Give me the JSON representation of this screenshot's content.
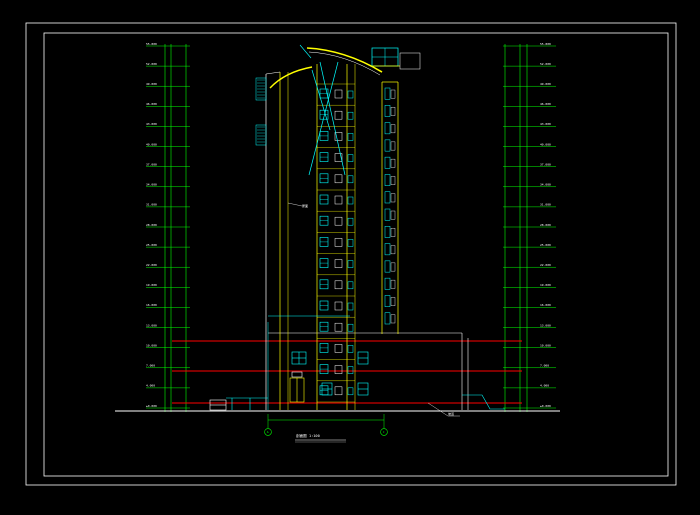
{
  "drawing": {
    "title": "剖面图 1:100",
    "colors": {
      "background": "#000000",
      "frame": "#ffffff",
      "wall": "#ffff00",
      "window": "#00ffff",
      "floor_band": "#ff0000",
      "dim": "#00ff00",
      "ground": "#ffffff"
    },
    "left_levels": [
      "55.800",
      "52.000",
      "49.000",
      "46.000",
      "43.000",
      "40.000",
      "37.000",
      "34.000",
      "31.000",
      "28.000",
      "25.000",
      "22.000",
      "19.000",
      "16.000",
      "13.000",
      "10.000",
      "7.000",
      "4.000",
      "±0.000"
    ],
    "right_levels": [
      "55.800",
      "52.000",
      "49.000",
      "46.000",
      "43.000",
      "40.000",
      "37.000",
      "34.000",
      "31.000",
      "28.000",
      "25.000",
      "22.000",
      "19.000",
      "16.000",
      "13.000",
      "10.000",
      "7.000",
      "4.000",
      "±0.000"
    ],
    "axis_labels": [
      "A",
      "C"
    ],
    "callouts": [
      "屋面",
      "坡道"
    ]
  }
}
